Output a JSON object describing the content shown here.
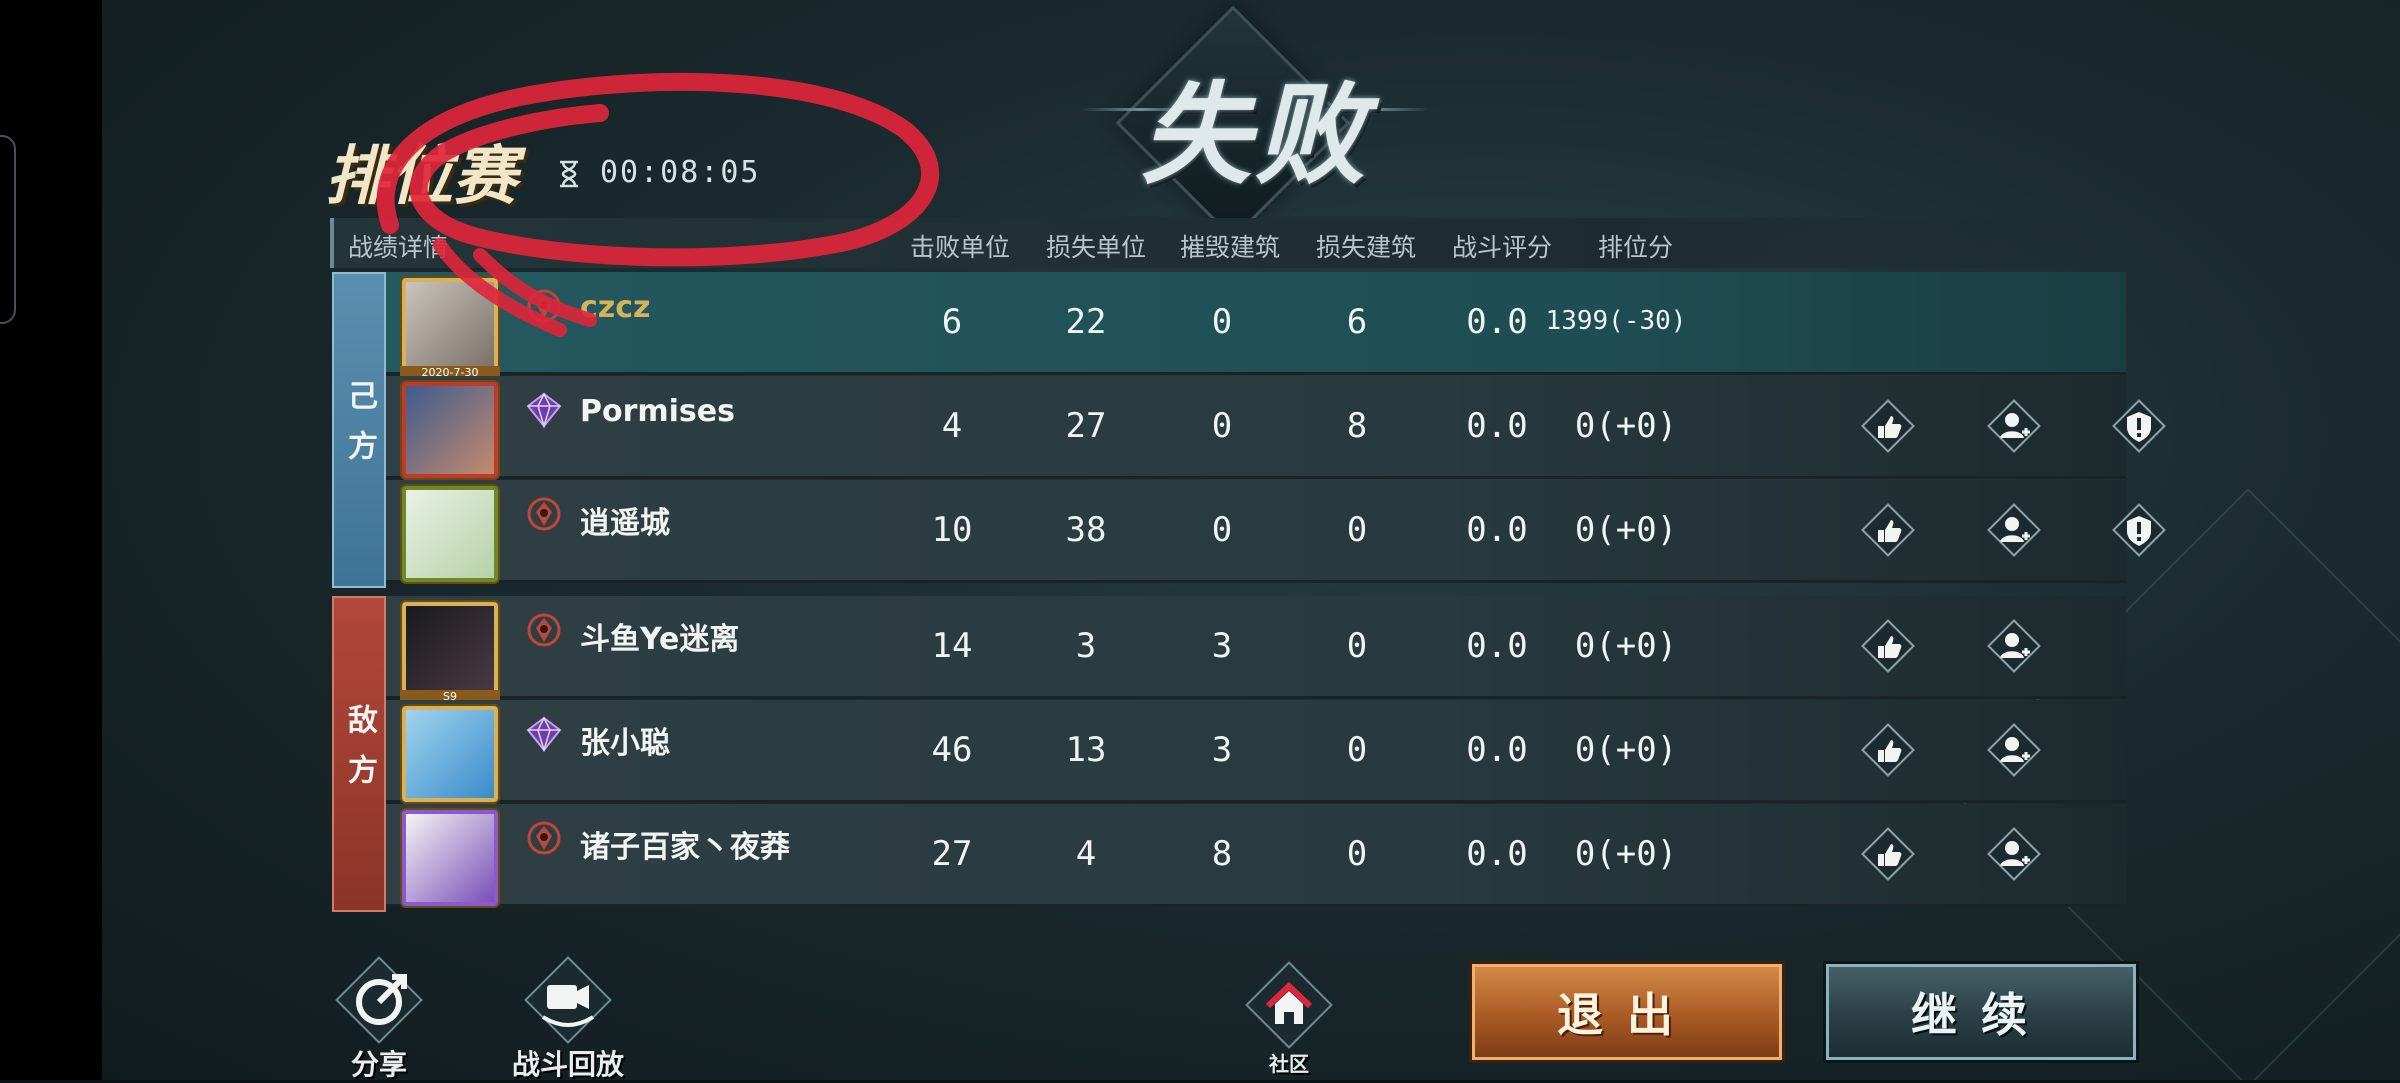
{
  "result": {
    "title": "失败"
  },
  "mode": {
    "title": "排位赛",
    "timer": "00:08:05"
  },
  "header": {
    "detail": "战绩详情",
    "columns": [
      "击败单位",
      "损失单位",
      "摧毁建筑",
      "损失建筑",
      "战斗评分",
      "排位分"
    ]
  },
  "sides": {
    "ally": "己方",
    "enemy": "敌方"
  },
  "players": [
    {
      "name": "czcz",
      "avatar_badge": "2020-7-30",
      "stats": [
        "6",
        "22",
        "0",
        "6",
        "0.0",
        "1399(-30)"
      ]
    },
    {
      "name": "Pormises",
      "stats": [
        "4",
        "27",
        "0",
        "8",
        "0.0",
        "0(+0)"
      ]
    },
    {
      "name": "逍遥城",
      "stats": [
        "10",
        "38",
        "0",
        "0",
        "0.0",
        "0(+0)"
      ]
    },
    {
      "name": "斗鱼Ye迷离",
      "avatar_badge": "S9",
      "stats": [
        "14",
        "3",
        "3",
        "0",
        "0.0",
        "0(+0)"
      ]
    },
    {
      "name": "张小聪",
      "stats": [
        "46",
        "13",
        "3",
        "0",
        "0.0",
        "0(+0)"
      ]
    },
    {
      "name": "诸子百家丶夜莽",
      "stats": [
        "27",
        "4",
        "8",
        "0",
        "0.0",
        "0(+0)"
      ]
    }
  ],
  "bottom": {
    "share": "分享",
    "replay": "战斗回放",
    "community": "社区",
    "exit": "退出",
    "continue": "继续"
  },
  "colors": {
    "ally": "#3e7496",
    "enemy": "#8b3428",
    "self_row": "#1e4d53",
    "exit": "#a95a24",
    "annotation": "#e0253a"
  },
  "icons": [
    "hourglass-icon",
    "like-icon",
    "add-friend-icon",
    "report-icon",
    "share-icon",
    "replay-icon",
    "home-icon",
    "rank-diamond-icon",
    "rank-crest-icon"
  ]
}
